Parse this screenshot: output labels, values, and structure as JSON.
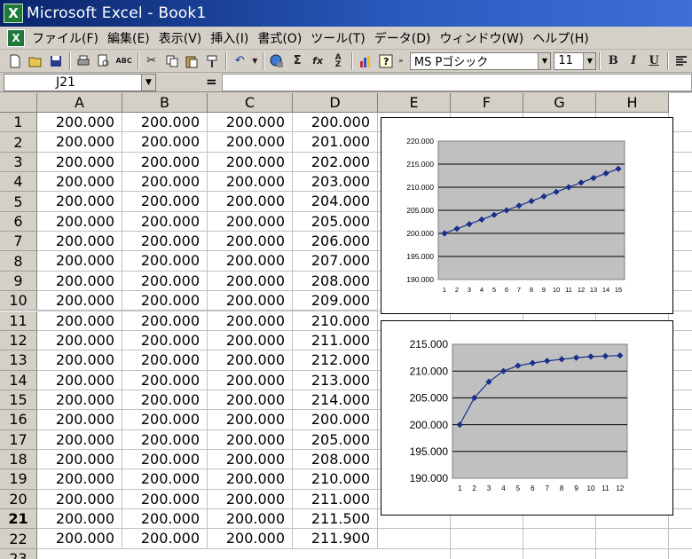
{
  "window": {
    "title": "Microsoft Excel - Book1",
    "app_icon": "X"
  },
  "menu": [
    "ファイル(F)",
    "編集(E)",
    "表示(V)",
    "挿入(I)",
    "書式(O)",
    "ツール(T)",
    "データ(D)",
    "ウィンドウ(W)",
    "ヘルプ(H)"
  ],
  "toolbar": {
    "font_name": "MS Pゴシック",
    "font_size": "11",
    "bold": "B",
    "italic": "I",
    "underline": "U",
    "sum": "Σ",
    "fx": "fx"
  },
  "formula_bar": {
    "name_box": "J21",
    "equals": "=",
    "value": ""
  },
  "columns": [
    "A",
    "B",
    "C",
    "D",
    "E",
    "F",
    "G",
    "H"
  ],
  "rows": [
    [
      "1",
      "200.000",
      "200.000",
      "200.000",
      "200.000"
    ],
    [
      "2",
      "200.000",
      "200.000",
      "200.000",
      "201.000"
    ],
    [
      "3",
      "200.000",
      "200.000",
      "200.000",
      "202.000"
    ],
    [
      "4",
      "200.000",
      "200.000",
      "200.000",
      "203.000"
    ],
    [
      "5",
      "200.000",
      "200.000",
      "200.000",
      "204.000"
    ],
    [
      "6",
      "200.000",
      "200.000",
      "200.000",
      "205.000"
    ],
    [
      "7",
      "200.000",
      "200.000",
      "200.000",
      "206.000"
    ],
    [
      "8",
      "200.000",
      "200.000",
      "200.000",
      "207.000"
    ],
    [
      "9",
      "200.000",
      "200.000",
      "200.000",
      "208.000"
    ],
    [
      "10",
      "200.000",
      "200.000",
      "200.000",
      "209.000"
    ],
    [
      "11",
      "200.000",
      "200.000",
      "200.000",
      "210.000"
    ],
    [
      "12",
      "200.000",
      "200.000",
      "200.000",
      "211.000"
    ],
    [
      "13",
      "200.000",
      "200.000",
      "200.000",
      "212.000"
    ],
    [
      "14",
      "200.000",
      "200.000",
      "200.000",
      "213.000"
    ],
    [
      "15",
      "200.000",
      "200.000",
      "200.000",
      "214.000"
    ],
    [
      "16",
      "200.000",
      "200.000",
      "200.000",
      "200.000"
    ],
    [
      "17",
      "200.000",
      "200.000",
      "200.000",
      "205.000"
    ],
    [
      "18",
      "200.000",
      "200.000",
      "200.000",
      "208.000"
    ],
    [
      "19",
      "200.000",
      "200.000",
      "200.000",
      "210.000"
    ],
    [
      "20",
      "200.000",
      "200.000",
      "200.000",
      "211.000"
    ],
    [
      "21",
      "200.000",
      "200.000",
      "200.000",
      "211.500"
    ],
    [
      "22",
      "200.000",
      "200.000",
      "200.000",
      "211.900"
    ]
  ],
  "active_row": "21",
  "colors": {
    "series": "#1a2f8a",
    "plot_area": "#c0c0c0",
    "titlebar": "#0a246a"
  },
  "chart_data": [
    {
      "type": "line",
      "x": [
        1,
        2,
        3,
        4,
        5,
        6,
        7,
        8,
        9,
        10,
        11,
        12,
        13,
        14,
        15
      ],
      "series": [
        {
          "values": [
            200,
            201,
            202,
            203,
            204,
            205,
            206,
            207,
            208,
            209,
            210,
            211,
            212,
            213,
            214
          ]
        }
      ],
      "ylim": [
        190,
        220
      ],
      "yticks": [
        "220.000",
        "215.000",
        "210.000",
        "205.000",
        "200.000",
        "195.000",
        "190.000"
      ],
      "grid": true,
      "legend": "none"
    },
    {
      "type": "line",
      "x": [
        1,
        2,
        3,
        4,
        5,
        6,
        7,
        8,
        9,
        10,
        11,
        12
      ],
      "series": [
        {
          "values": [
            200,
            205,
            208,
            210,
            211,
            211.5,
            211.9,
            212.2,
            212.5,
            212.7,
            212.8,
            212.9
          ]
        }
      ],
      "ylim": [
        190,
        215
      ],
      "yticks": [
        "215.000",
        "210.000",
        "205.000",
        "200.000",
        "195.000",
        "190.000"
      ],
      "grid": true,
      "legend": "none"
    }
  ]
}
